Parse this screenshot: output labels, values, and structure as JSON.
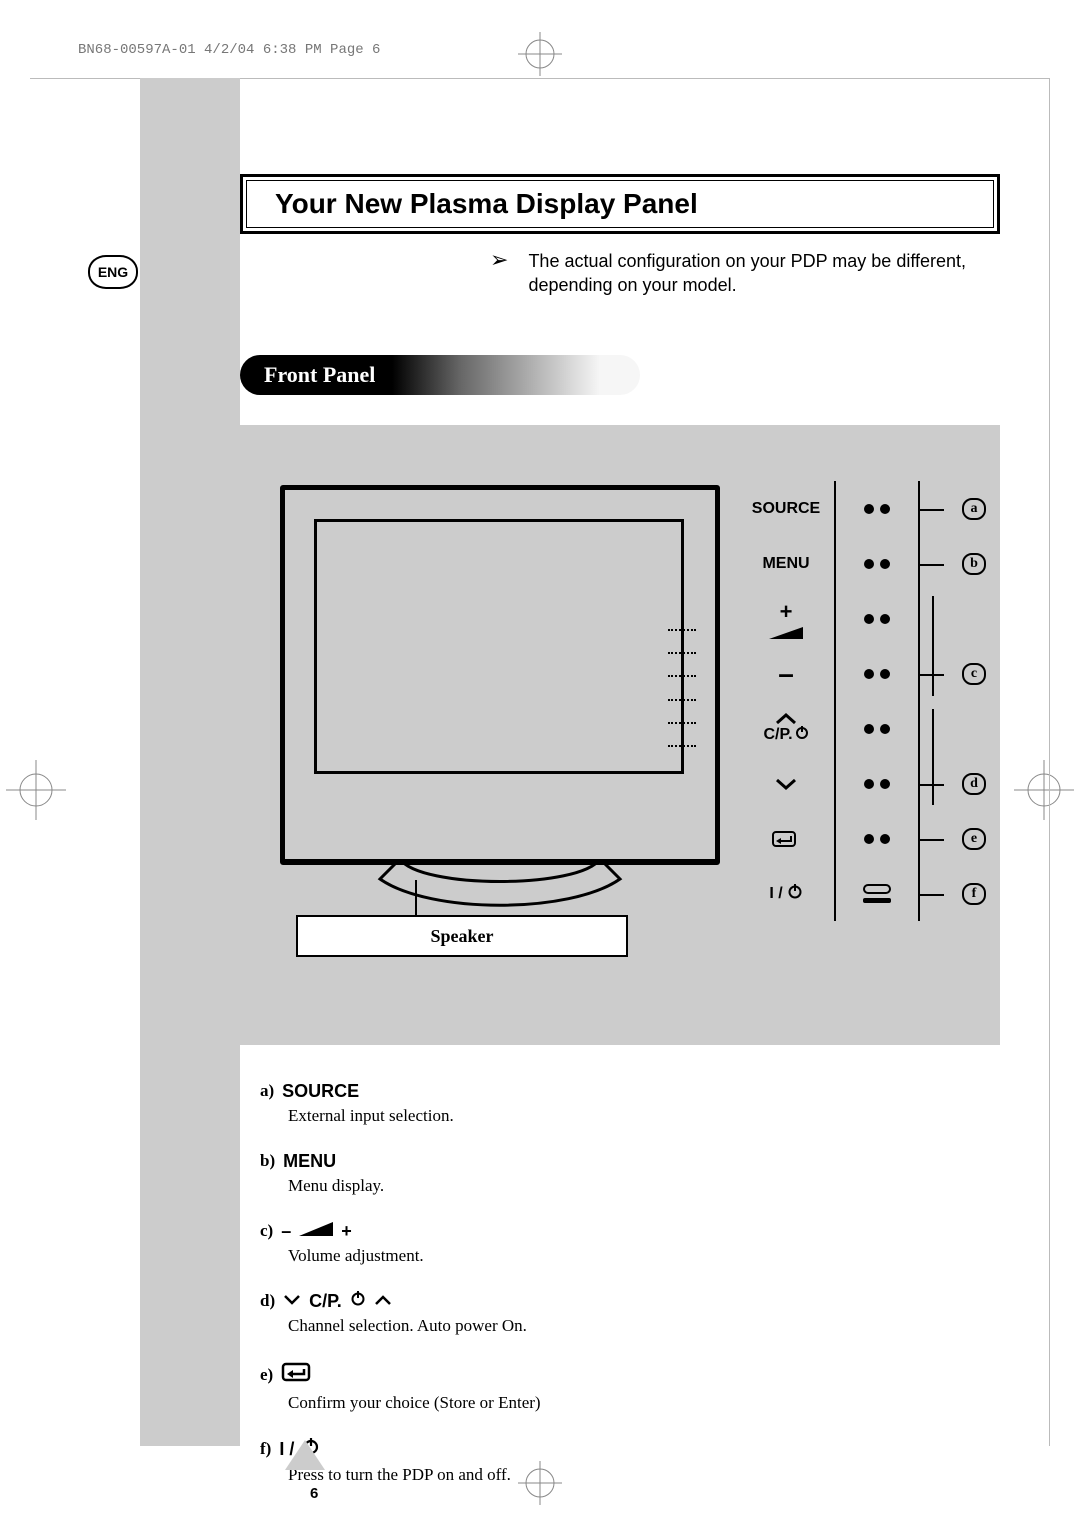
{
  "doc_header": "BN68-00597A-01  4/2/04  6:38 PM  Page 6",
  "lang_badge": "ENG",
  "title": "Your New Plasma Display Panel",
  "note": "The actual configuration on your PDP may be different, depending on your model.",
  "section_tab": "Front Panel",
  "speaker_label": "Speaker",
  "panel_labels": {
    "a": "SOURCE",
    "b": "MENU",
    "c_plus": "+",
    "c_minus": "–",
    "d": "C/P.",
    "f": "I /"
  },
  "callouts": {
    "a": "a",
    "b": "b",
    "c": "c",
    "d": "d",
    "e": "e",
    "f": "f"
  },
  "desc": {
    "a": {
      "key_letter": "a)",
      "key_label": "SOURCE",
      "body": "External input selection."
    },
    "b": {
      "key_letter": "b)",
      "key_label": "MENU",
      "body": "Menu display."
    },
    "c": {
      "key_letter": "c)",
      "key_label_pre": "–",
      "key_label_post": "+",
      "body": "Volume adjustment."
    },
    "d": {
      "key_letter": "d)",
      "key_label": "C/P.",
      "body": "Channel selection. Auto power On."
    },
    "e": {
      "key_letter": "e)",
      "body": "Confirm your choice (Store or Enter)"
    },
    "f": {
      "key_letter": "f)",
      "key_label": "I /",
      "body": "Press to turn the PDP on and off."
    }
  },
  "page_number": "6"
}
